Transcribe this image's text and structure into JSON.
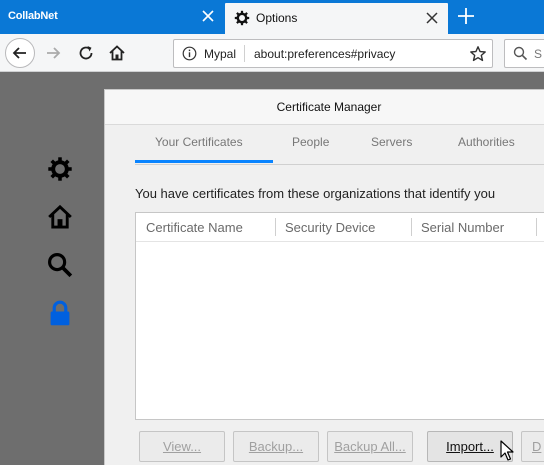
{
  "tabs": [
    {
      "title": "CollabNet"
    },
    {
      "title": "Options"
    }
  ],
  "navbar": {
    "site_label": "Mypal",
    "url": "about:preferences#privacy",
    "search_placeholder": "S"
  },
  "sidebar": [
    "gear-icon",
    "home-icon",
    "search-icon",
    "lock-icon"
  ],
  "dialog": {
    "title": "Certificate Manager",
    "tabs": [
      "Your Certificates",
      "People",
      "Servers",
      "Authorities"
    ],
    "description": "You have certificates from these organizations that identify you",
    "columns": [
      "Certificate Name",
      "Security Device",
      "Serial Number"
    ],
    "buttons": {
      "view": "View...",
      "backup": "Backup...",
      "backup_all": "Backup All...",
      "import": "Import...",
      "delete": "D"
    }
  },
  "colors": {
    "accent": "#0a84ff",
    "tabstrip": "#0a78d6",
    "lock": "#0060df"
  }
}
